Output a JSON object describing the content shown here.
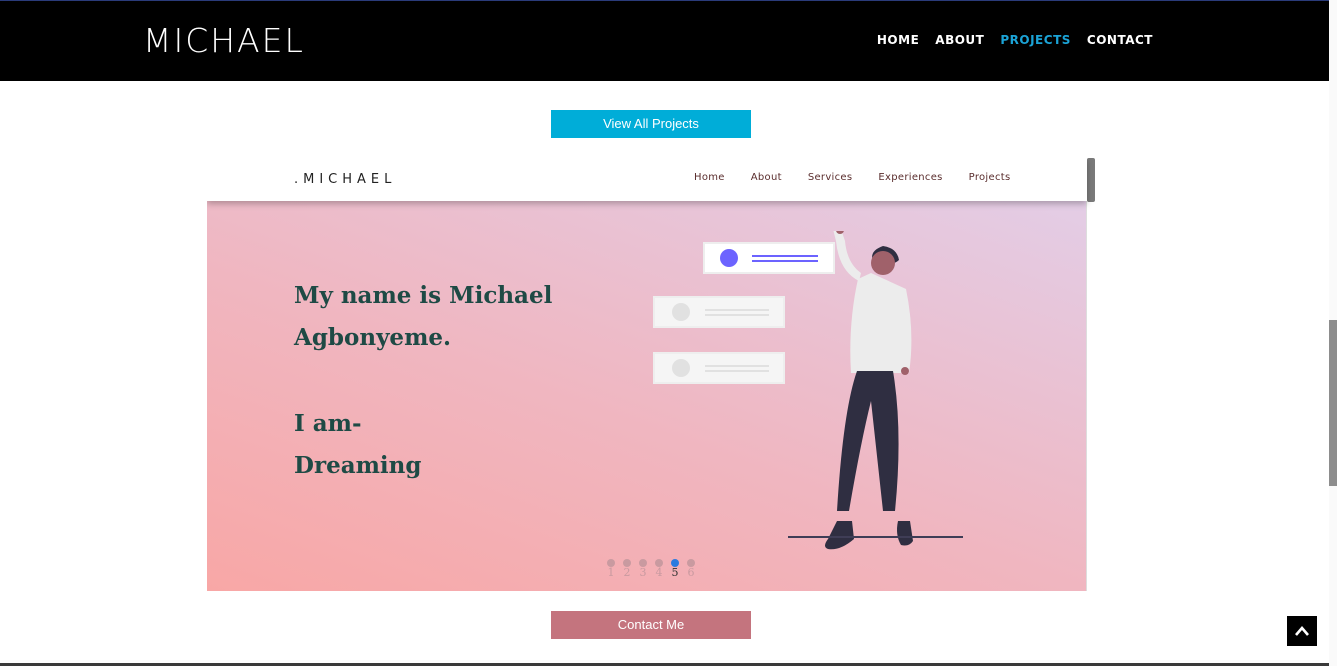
{
  "site": {
    "brand": "MICHAEL"
  },
  "nav": [
    {
      "label": "HOME",
      "active": false
    },
    {
      "label": "ABOUT",
      "active": false
    },
    {
      "label": "PROJECTS",
      "active": true
    },
    {
      "label": "CONTACT",
      "active": false
    }
  ],
  "actions": {
    "view_all_label": "View All Projects",
    "contact_label": "Contact Me"
  },
  "preview": {
    "brand": ".MICHAEL",
    "links": [
      "Home",
      "About",
      "Services",
      "Experiences",
      "Projects"
    ],
    "hero": {
      "line1": "My name is Michael",
      "line2": "Agbonyeme.",
      "line3": "I am-",
      "line4": "Dreaming"
    },
    "slides": [
      "1",
      "2",
      "3",
      "4",
      "5",
      "6"
    ],
    "active_slide": 5
  },
  "colors": {
    "accent": "#1ba3d6",
    "view_button": "#00add8",
    "contact_button": "#c4747e",
    "hero_text": "#1e4a45"
  },
  "icons": {
    "back_to_top": "chevron-up-icon"
  }
}
